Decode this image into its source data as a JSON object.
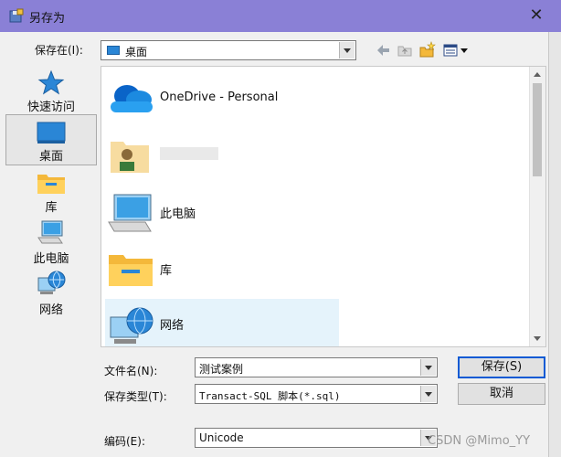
{
  "window": {
    "title": "另存为",
    "close_symbol": "✕"
  },
  "save_in": {
    "label": "保存在(I):",
    "value": "桌面"
  },
  "places": [
    {
      "label": "快速访问",
      "icon": "star-icon"
    },
    {
      "label": "桌面",
      "icon": "desktop-icon",
      "selected": true
    },
    {
      "label": "库",
      "icon": "library-folder-icon"
    },
    {
      "label": "此电脑",
      "icon": "computer-icon"
    },
    {
      "label": "网络",
      "icon": "network-icon"
    }
  ],
  "files": [
    {
      "name": "OneDrive - Personal",
      "icon": "onedrive-cloud-icon"
    },
    {
      "name": "",
      "icon": "user-folder-icon"
    },
    {
      "name": "此电脑",
      "icon": "computer-icon"
    },
    {
      "name": "库",
      "icon": "library-folder-icon"
    },
    {
      "name": "网络",
      "icon": "network-icon",
      "highlighted": true
    }
  ],
  "form": {
    "filename_label": "文件名(N):",
    "filename_value": "测试案例",
    "filetype_label": "保存类型(T):",
    "filetype_value": "Transact-SQL 脚本(*.sql)",
    "encoding_label": "编码(E):",
    "encoding_value": "Unicode"
  },
  "buttons": {
    "save": "保存(S)",
    "cancel": "取消"
  },
  "watermark": "CSDN @Mimo_YY",
  "colors": {
    "titlebar": "#8a80d6",
    "accent": "#0a5ad4",
    "desktop_blue": "#2a86d6",
    "folder_yellow": "#f4b83a"
  }
}
